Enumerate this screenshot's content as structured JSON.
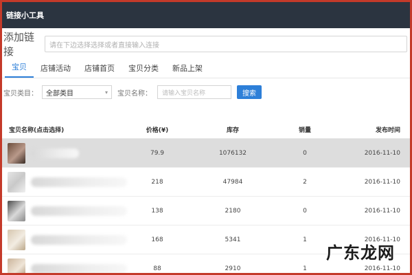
{
  "app": {
    "title": "链接小工具"
  },
  "add_link": {
    "label": "添加链接",
    "placeholder": "请在下边选择选择或者直接输入连接"
  },
  "tabs": [
    {
      "label": "宝贝",
      "active": true
    },
    {
      "label": "店铺活动",
      "active": false
    },
    {
      "label": "店铺首页",
      "active": false
    },
    {
      "label": "宝贝分类",
      "active": false
    },
    {
      "label": "新品上架",
      "active": false
    }
  ],
  "filters": {
    "category_label": "宝贝类目：",
    "category_value": "全部类目",
    "name_label": "宝贝名称：",
    "name_placeholder": "请输入宝贝名称",
    "search_label": "搜索"
  },
  "table": {
    "headers": [
      "宝贝名称(点击选择)",
      "价格(¥)",
      "库存",
      "销量",
      "发布时间"
    ],
    "rows": [
      {
        "price": "79.9",
        "stock": "1076132",
        "sales": "0",
        "date": "2016-11-10",
        "selected": true
      },
      {
        "price": "218",
        "stock": "47984",
        "sales": "2",
        "date": "2016-11-10",
        "selected": false
      },
      {
        "price": "138",
        "stock": "2180",
        "sales": "0",
        "date": "2016-11-10",
        "selected": false
      },
      {
        "price": "168",
        "stock": "5341",
        "sales": "1",
        "date": "2016-11-10",
        "selected": false
      },
      {
        "price": "88",
        "stock": "2910",
        "sales": "1",
        "date": "2016-11-10",
        "selected": false
      }
    ]
  },
  "watermark": "广东龙网",
  "colors": {
    "accent": "#2d7fd8",
    "topbar": "#2b3440",
    "frame": "#c43a2a"
  }
}
